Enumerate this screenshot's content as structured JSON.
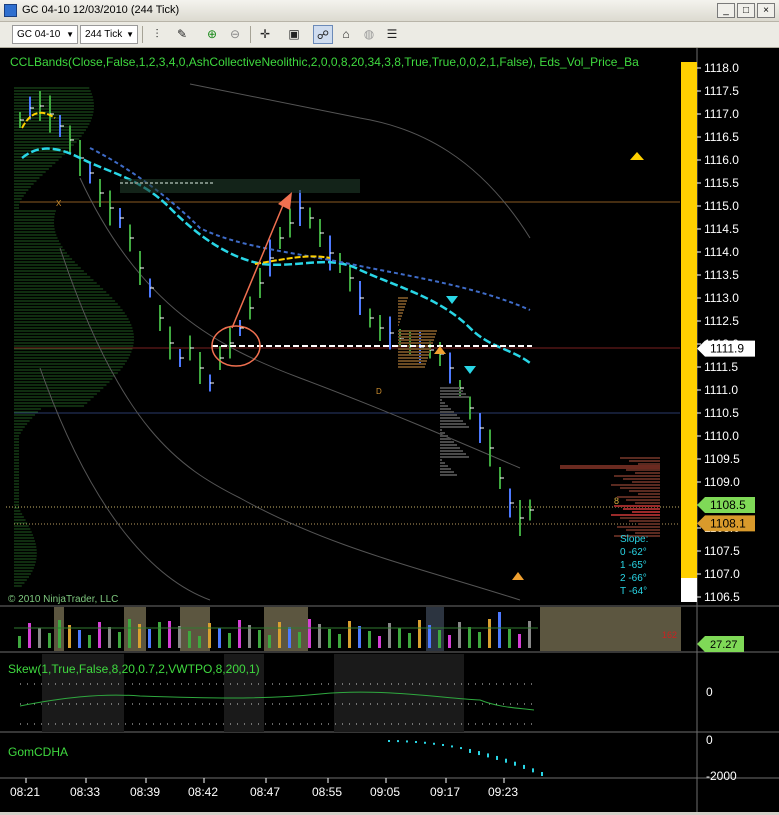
{
  "window": {
    "title": "GC 04-10  12/03/2010 (244 Tick)",
    "controls": [
      "_",
      "□",
      "×"
    ]
  },
  "toolbar": {
    "instrument": "GC 04-10",
    "interval": "244 Tick",
    "icons": [
      "bar-type-icon",
      "pencil-icon",
      "zoom-in-icon",
      "zoom-out-icon",
      "crosshair-icon",
      "properties-icon",
      "indicators-icon",
      "strategies-icon",
      "globe-icon",
      "data-box-icon"
    ]
  },
  "indicator_label": "CCLBands(Close,False,1,2,3,4,0,AshCollectiveNeolithic,2,0,0,8,20,34,3,8,True,True,0,0,2,1,False), Eds_Vol_Price_Ba",
  "copyright": "© 2010 NinjaTrader, LLC",
  "price_axis": {
    "ticks": [
      "1118.0",
      "1117.5",
      "1117.0",
      "1116.5",
      "1116.0",
      "1115.5",
      "1115.0",
      "1114.5",
      "1114.0",
      "1113.5",
      "1113.0",
      "1112.5",
      "1112.0",
      "1111.5",
      "1111.0",
      "1110.5",
      "1110.0",
      "1109.5",
      "1109.0",
      "1108.5",
      "1108.0",
      "1107.5",
      "1107.0",
      "1106.5"
    ],
    "min": 1106.5,
    "max": 1118.0,
    "markers": [
      {
        "label": "1111.9",
        "value": 1111.9,
        "color": "#ffffff",
        "text_color": "#000000"
      },
      {
        "label": "1108.5",
        "value": 1108.5,
        "color": "#7fd957",
        "text_color": "#000000"
      },
      {
        "label": "1108.1",
        "value": 1108.1,
        "color": "#d99a2b",
        "text_color": "#000000"
      }
    ]
  },
  "slope_box": {
    "title": "Slope:",
    "rows": [
      "0  -62°",
      "1  -65°",
      "2  -66°",
      "T  -64°"
    ]
  },
  "annotations": {
    "small_label_8": "8",
    "x_mark": "X",
    "d_mark": "D"
  },
  "volume_panel": {
    "value_label": "162",
    "axis_marker": "27.27"
  },
  "skew_panel": {
    "label": "Skew(1,True,False,8,20,0.7,2,VWTPO,8,200,1)",
    "axis_tick": "0"
  },
  "cdha_panel": {
    "label": "GomCDHA",
    "axis_ticks": [
      "0",
      "-2000"
    ]
  },
  "time_axis": [
    "08:21",
    "08:33",
    "08:39",
    "08:42",
    "08:47",
    "08:55",
    "09:05",
    "09:17",
    "09:23"
  ],
  "colors": {
    "bar_up": "#3fa83f",
    "bar_down": "#4d79ff",
    "signal_cyan": "#29d6e6",
    "band_yellow": "#ffd000",
    "arrow_orange": "#f07050"
  }
}
